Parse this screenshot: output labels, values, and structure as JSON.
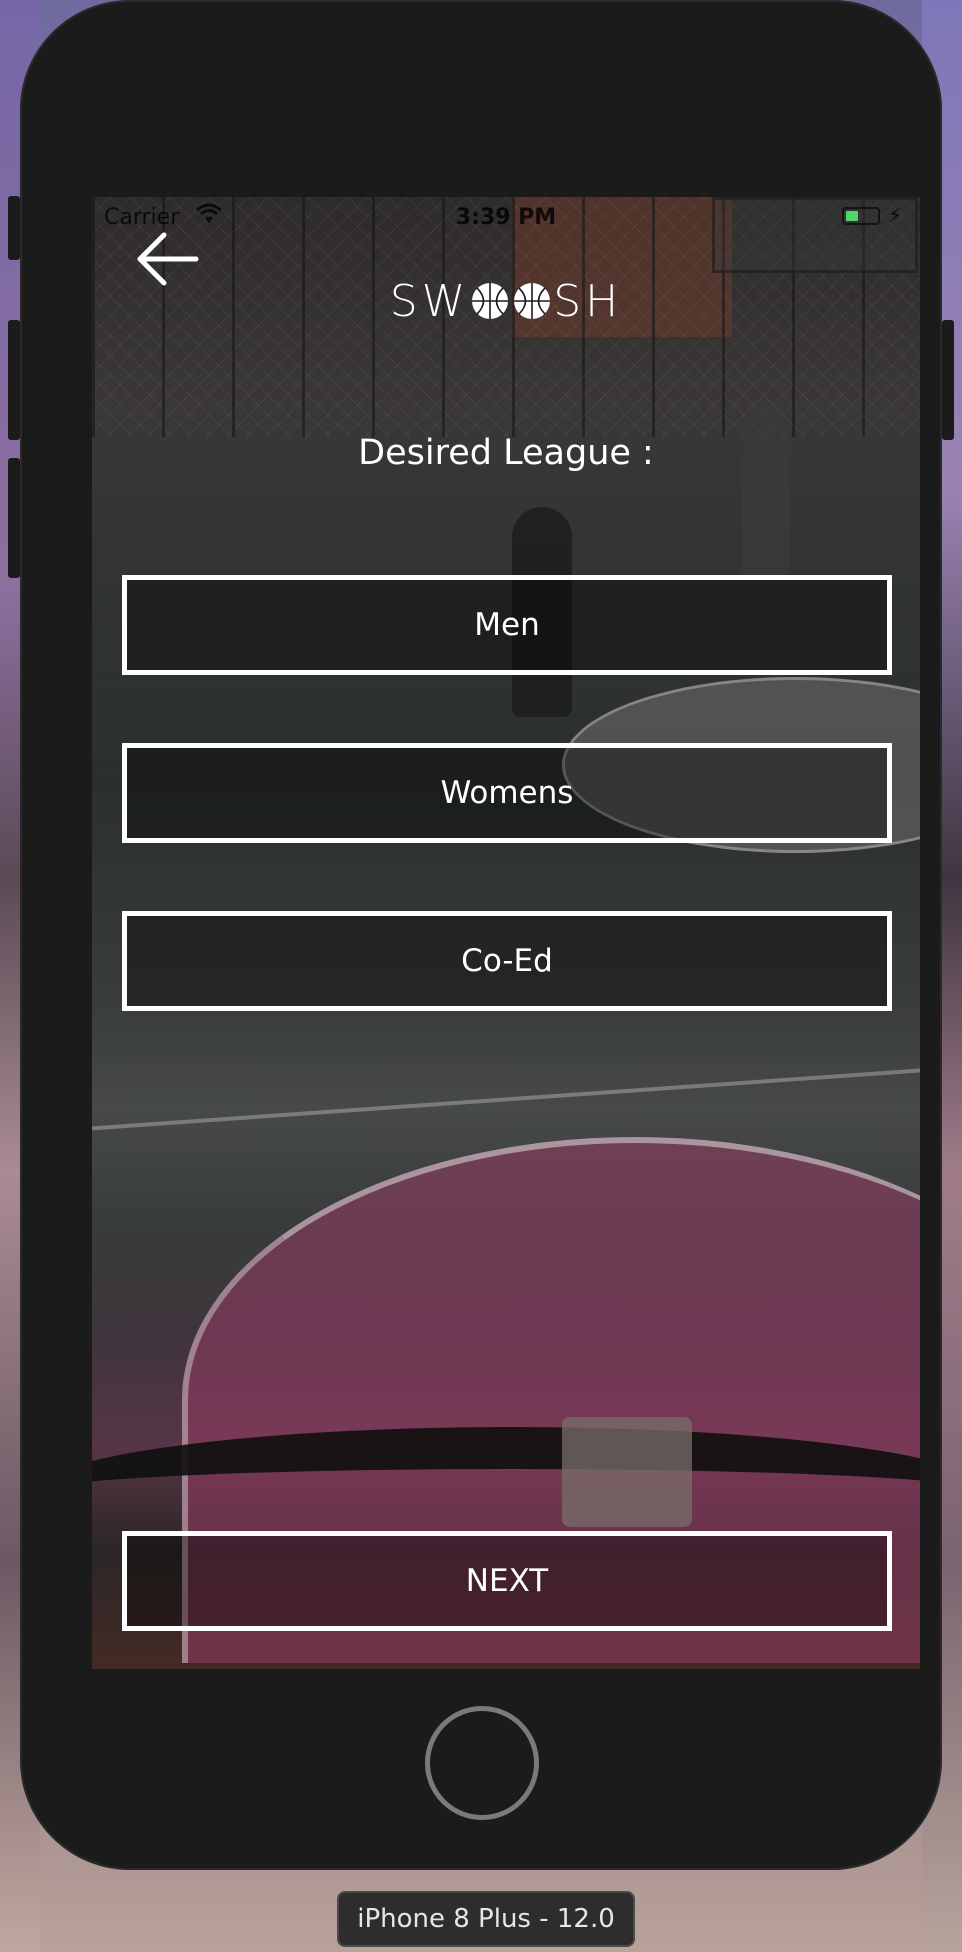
{
  "status_bar": {
    "carrier": "Carrier",
    "time": "3:39 PM",
    "battery_color": "#4cd964"
  },
  "nav": {
    "back_icon": "arrow-left-icon",
    "logo_left": "SW",
    "logo_right": "SH",
    "logo_ball_icon": "basketball-icon"
  },
  "screen": {
    "heading": "Desired League :",
    "options": [
      {
        "label": "Men"
      },
      {
        "label": "Womens"
      },
      {
        "label": "Co-Ed"
      }
    ],
    "next_label": "NEXT"
  },
  "simulator": {
    "device_label": "iPhone 8 Plus - 12.0"
  },
  "colors": {
    "accent": "#ffffff",
    "phone_body": "#1b1b1c"
  }
}
